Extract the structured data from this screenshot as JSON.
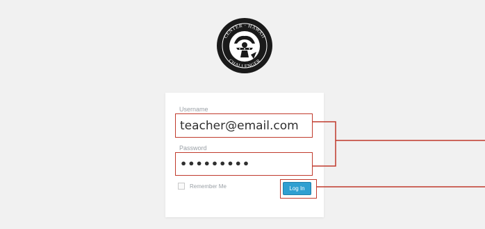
{
  "logo": {
    "text": "CHALLENGER CENTER HAWAII",
    "icon": "challenger-center-hawaii-seal"
  },
  "form": {
    "username_label": "Username",
    "username_value": "teacher@email.com",
    "password_label": "Password",
    "password_value": "•••••••••",
    "remember_label": "Remember Me",
    "remember_checked": false,
    "login_label": "Log In"
  },
  "colors": {
    "background": "#f1f1f1",
    "card": "#ffffff",
    "highlight": "#c0392b",
    "button": "#2f9fd1"
  }
}
